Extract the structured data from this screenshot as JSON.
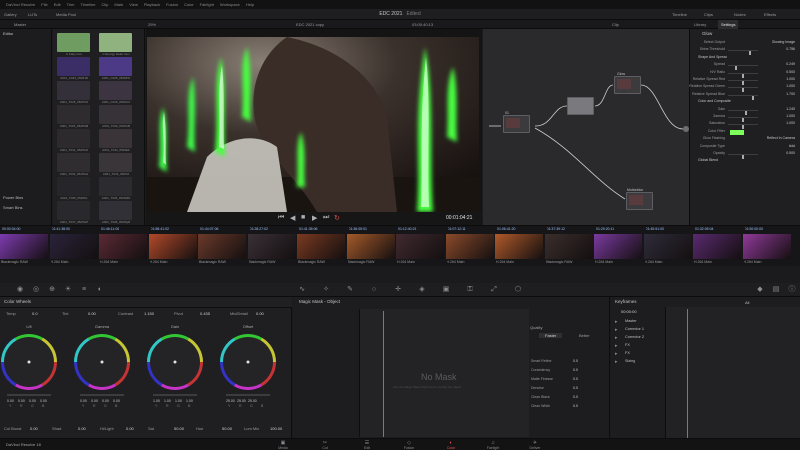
{
  "app": {
    "menu": [
      "DaVinci Resolve",
      "File",
      "Edit",
      "Trim",
      "Timeline",
      "Clip",
      "Mark",
      "View",
      "Playback",
      "Fusion",
      "Color",
      "Fairlight",
      "Workspace",
      "Help"
    ],
    "project_title": "EDC 2021",
    "project_status": "Edited",
    "top_right": [
      "Timeline",
      "Clips",
      "Nodes",
      "Effects"
    ],
    "gallery": "Gallery",
    "luts": "LUTs",
    "media_pool_tab": "Media Pool"
  },
  "viewer": {
    "zoom": "29%",
    "timeline_name": "EDC 2021 copy",
    "timecode_top": "03:00:40:13",
    "clip_mode": "Clip",
    "timecode": "00:01:04:21"
  },
  "left": {
    "master": "Master",
    "power_bins": "Power Bins",
    "smart_bins": "Smart Bins",
    "folder": "Editor"
  },
  "media_pool": [
    {
      "label": "C Fairy.mov",
      "color": "#6e9c61"
    },
    {
      "label": "C Energy Heart.mov",
      "color": "#8fb27f"
    },
    {
      "label": "A001_C023_0525JR",
      "color": "#3b2e66"
    },
    {
      "label": "A001_C025_0525PO",
      "color": "#4d3a86"
    },
    {
      "label": "A001_T025_0525XO",
      "color": "#34303a"
    },
    {
      "label": "A001_C029_0525UU",
      "color": "#3c3440"
    },
    {
      "label": "A001_T025_0525NM",
      "color": "#2f2c30"
    },
    {
      "label": "A001_T030_0525AB",
      "color": "#363238"
    },
    {
      "label": "A001_T031_0525CD",
      "color": "#2c2a2d"
    },
    {
      "label": "A001_T032_0525EF",
      "color": "#3a3439"
    },
    {
      "label": "A001_T033_0525GH",
      "color": "#302d31"
    },
    {
      "label": "A001_T034_0525IJ",
      "color": "#3a3538"
    },
    {
      "label": "A001_T035_0525KL",
      "color": "#26252a"
    },
    {
      "label": "A001_T036_0525MN",
      "color": "#2c2b2f"
    },
    {
      "label": "A001_T037_0525OP",
      "color": "#29282c"
    },
    {
      "label": "A001_T038_0525QR",
      "color": "#313036"
    }
  ],
  "nodes": {
    "labels": [
      "01",
      "Glow",
      "Motionblur"
    ]
  },
  "settings": {
    "tabs": [
      "Library",
      "Settings"
    ],
    "effect": "Glow",
    "rows": [
      {
        "label": "Select Output",
        "value": "Glowing Image",
        "level": null
      },
      {
        "label": "Shine Threshold",
        "value": "0.756",
        "level": 0.76
      },
      {
        "label": "Shape And Spread",
        "value": "",
        "level": null,
        "section": true
      },
      {
        "label": "Spread",
        "value": "0.249",
        "level": 0.25
      },
      {
        "label": "H/V Ratio",
        "value": "0.500",
        "level": 0.5
      },
      {
        "label": "Relative Spread Red",
        "value": "1.000",
        "level": 0.5
      },
      {
        "label": "Relative Spread Green",
        "value": "1.000",
        "level": 0.5
      },
      {
        "label": "Relative Spread Blue",
        "value": "1.700",
        "level": 0.85
      },
      {
        "label": "Color and Composite",
        "value": "",
        "level": null,
        "section": true
      },
      {
        "label": "Gain",
        "value": "1.249",
        "level": 0.62
      },
      {
        "label": "Gamma",
        "value": "1.000",
        "level": 0.5
      },
      {
        "label": "Saturation",
        "value": "1.000",
        "level": 0.5
      },
      {
        "label": "Color Filter",
        "value": "",
        "level": null,
        "swatch": "#7dff5a"
      },
      {
        "label": "Glow Flashing",
        "value": "Reflect In Camera",
        "level": null
      },
      {
        "label": "Composite Type",
        "value": "Add",
        "level": null
      },
      {
        "label": "Opacity",
        "value": "0.500",
        "level": 0.5
      },
      {
        "label": "Global Blend",
        "value": "",
        "level": null,
        "section": true
      }
    ]
  },
  "timeline": {
    "clips": [
      {
        "index": "01",
        "tc": "00:00:04:00",
        "name": "Blackmagic RAW",
        "color": "#7e3bb0"
      },
      {
        "index": "02",
        "tc": "01:41:38:00",
        "name": "H.264 Main",
        "color": "#2a233b"
      },
      {
        "index": "03",
        "tc": "01:46:11:00",
        "name": "H.264 Main",
        "color": "#5a2a35"
      },
      {
        "index": "04",
        "tc": "01:58:41:02",
        "name": "H.264 Main",
        "color": "#b34a2a"
      },
      {
        "index": "05",
        "tc": "01:44:07:06",
        "name": "Blackmagic RAW",
        "color": "#6a3a2a"
      },
      {
        "index": "06",
        "tc": "01:28:27:02",
        "name": "Blackmagic RAW",
        "color": "#3a3036"
      },
      {
        "index": "07",
        "tc": "01:41:35:06",
        "name": "Blackmagic RAW",
        "color": "#7a3a20"
      },
      {
        "index": "08",
        "tc": "01:36:05:01",
        "name": "Blackmagic RAW",
        "color": "#a55a2a"
      },
      {
        "index": "09",
        "tc": "01:12:40:21",
        "name": "H.264 Main",
        "color": "#402a30"
      },
      {
        "index": "10",
        "tc": "01:07:12:11",
        "name": "H.264 Main",
        "color": "#8a4a2a"
      },
      {
        "index": "11",
        "tc": "01:06:41:20",
        "name": "H.264 Main",
        "color": "#b05a2a"
      },
      {
        "index": "12",
        "tc": "01:37:39:12",
        "name": "Blackmagic RAW",
        "color": "#3b2e2c"
      },
      {
        "index": "13",
        "tc": "01:29:20:11",
        "name": "H.264 Main",
        "color": "#7a3aa0"
      },
      {
        "index": "14",
        "tc": "01:45:51:00",
        "name": "H.264 Main",
        "color": "#2e2c3a"
      },
      {
        "index": "15",
        "tc": "01:32:05:04",
        "name": "H.264 Main",
        "color": "#5a2a70"
      },
      {
        "index": "16",
        "tc": "01:50:00:00",
        "name": "H.264 Main",
        "color": "#903a9a"
      }
    ]
  },
  "color_wheels": {
    "title": "Color Wheels",
    "params": [
      {
        "label": "Temp",
        "value": "0.0"
      },
      {
        "label": "Tint",
        "value": "0.00"
      },
      {
        "label": "Contrast",
        "value": "1.150"
      },
      {
        "label": "Pivot",
        "value": "0.435"
      },
      {
        "label": "Mid/Detail",
        "value": "0.00"
      }
    ],
    "wheels": [
      {
        "name": "Lift",
        "values": [
          "0.00",
          "0.00",
          "0.00",
          "0.00"
        ]
      },
      {
        "name": "Gamma",
        "values": [
          "0.00",
          "0.00",
          "0.00",
          "0.00"
        ]
      },
      {
        "name": "Gain",
        "values": [
          "1.00",
          "1.00",
          "1.00",
          "1.00"
        ]
      },
      {
        "name": "Offset",
        "values": [
          "25.00",
          "25.00",
          "25.00",
          ""
        ]
      }
    ],
    "channels": [
      "Y",
      "R",
      "G",
      "B"
    ],
    "bottom": [
      {
        "label": "Col Boost",
        "value": "0.00"
      },
      {
        "label": "Shad",
        "value": "0.00"
      },
      {
        "label": "Hi/Light",
        "value": "0.00"
      },
      {
        "label": "Sat",
        "value": "50.00"
      },
      {
        "label": "Hue",
        "value": "50.00"
      },
      {
        "label": "Lum Mix",
        "value": "100.00"
      }
    ]
  },
  "magic_mask": {
    "title": "Magic Mask - Object",
    "empty_text": "No Mask",
    "empty_hint": "Use the Magic Mask Paint tool to identify the object",
    "quality": "Quality",
    "faster": "Faster",
    "better": "Better",
    "mask_finesse": [
      {
        "label": "Smart Refine",
        "value": "0.0"
      },
      {
        "label": "Consistency",
        "value": "0.0"
      },
      {
        "label": "Matte Finesse",
        "value": "0.0"
      },
      {
        "label": "Denoise",
        "value": "0.0"
      },
      {
        "label": "Clean Black",
        "value": "0.0"
      },
      {
        "label": "Clean White",
        "value": "0.0"
      }
    ]
  },
  "keyframes": {
    "title": "Keyframes",
    "filter": "All",
    "tc": "00:00:00",
    "tracks": [
      "Master",
      "Corrector 1",
      "Corrector 2",
      "FX",
      "FX",
      "Sizing"
    ]
  },
  "pages": [
    {
      "name": "Media",
      "icon": "▣"
    },
    {
      "name": "Cut",
      "icon": "✂"
    },
    {
      "name": "Edit",
      "icon": "☰"
    },
    {
      "name": "Fusion",
      "icon": "◇"
    },
    {
      "name": "Color",
      "icon": "◐"
    },
    {
      "name": "Fairlight",
      "icon": "♫"
    },
    {
      "name": "Deliver",
      "icon": "✈"
    }
  ],
  "active_page": "Color",
  "app_name": "DaVinci Resolve 18"
}
